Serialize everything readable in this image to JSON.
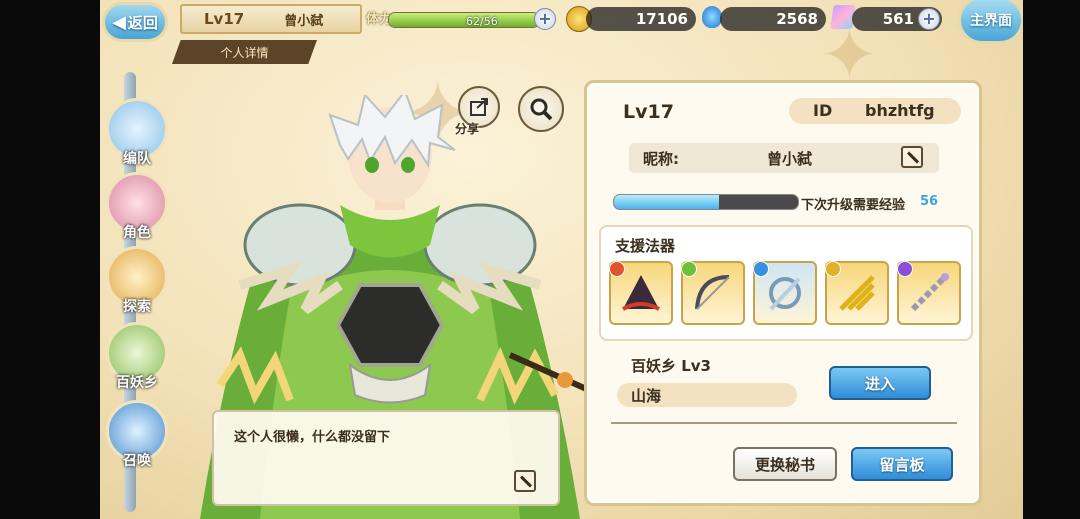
{
  "topbar": {
    "back_label": "返回",
    "level": "Lv17",
    "player_name": "曾小弑",
    "detail_tab": "个人详情",
    "stamina_label": "体力",
    "stamina_value": "62/56",
    "stamina_fraction": 1.0,
    "gold": "17106",
    "gems": "2568",
    "crystals": "561",
    "home_label": "主界面"
  },
  "side_menu": [
    {
      "label": "编队",
      "icon": "team-icon"
    },
    {
      "label": "角色",
      "icon": "character-icon"
    },
    {
      "label": "探索",
      "icon": "explore-icon"
    },
    {
      "label": "百妖乡",
      "icon": "village-icon"
    },
    {
      "label": "召唤",
      "icon": "summon-icon"
    }
  ],
  "actions": {
    "share_label": "分享"
  },
  "speech": {
    "text": "这个人很懒，什么都没留下"
  },
  "panel": {
    "level": "Lv17",
    "id_key": "ID",
    "id_value": "bhzhtfg",
    "nickname_key": "昵称:",
    "nickname_value": "曾小弑",
    "exp_label": "下次升级需要经验",
    "exp_value": "56",
    "exp_fraction": 0.57,
    "support_title": "支援法器",
    "support_items": [
      {
        "icon": "fan-weapon-icon",
        "gem": "#e0562a",
        "bg": "#f6d77a"
      },
      {
        "icon": "bow-weapon-icon",
        "gem": "#6fbf3a",
        "bg": "#f6d77a"
      },
      {
        "icon": "blade-weapon-icon",
        "gem": "#3a8fe0",
        "bg": "#cfe6f5"
      },
      {
        "icon": "claw-weapon-icon",
        "gem": "#e0b22a",
        "bg": "#f6d77a"
      },
      {
        "icon": "chain-weapon-icon",
        "gem": "#8a4fd6",
        "bg": "#f6d77a"
      }
    ],
    "village_line": "百妖乡  Lv3",
    "region": "山海",
    "enter_label": "进入",
    "change_secretary_label": "更换秘书",
    "message_board_label": "留言板"
  },
  "colors": {
    "accent_blue": "#2f8ed8",
    "panel_border": "#d9c48f",
    "text_dark": "#3b2f1e"
  }
}
